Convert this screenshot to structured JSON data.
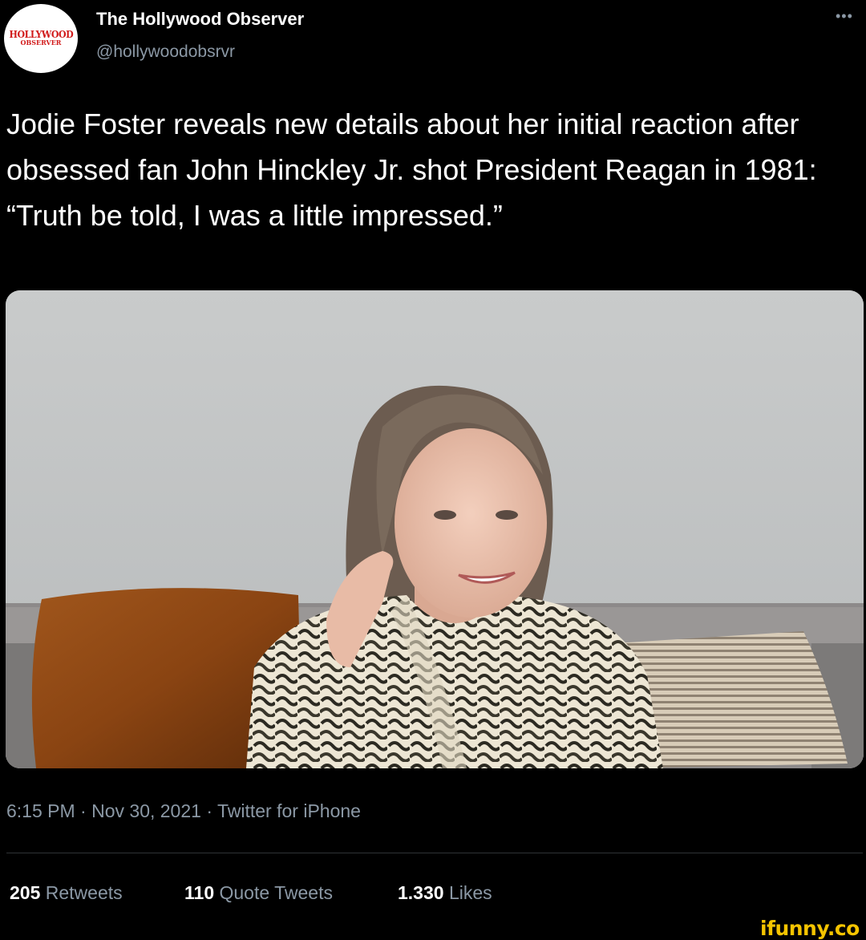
{
  "account": {
    "avatar_logo_line1": "HOLLYWOOD",
    "avatar_logo_line2": "OBSERVER",
    "name": "The Hollywood Observer",
    "handle": "@hollywoodobsrvr",
    "more_icon": "more-icon"
  },
  "tweet": {
    "text": "Jodie Foster reveals new details about her initial reaction after obsessed fan John Hinckley Jr. shot President Reagan in 1981: “Truth be told, I was a little impressed.”",
    "time": "6:15 PM",
    "date": "Nov 30, 2021",
    "source": "Twitter for iPhone",
    "separator": "·"
  },
  "stats": {
    "retweets_count": "205",
    "retweets_label": "Retweets",
    "quote_count": "110",
    "quote_label": "Quote Tweets",
    "likes_count": "1.330",
    "likes_label": "Likes"
  },
  "watermark": "ifunny.co",
  "colors": {
    "background": "#000000",
    "secondary_text": "#8b98a5",
    "watermark": "#f5c400",
    "logo_red": "#d11a1a"
  }
}
